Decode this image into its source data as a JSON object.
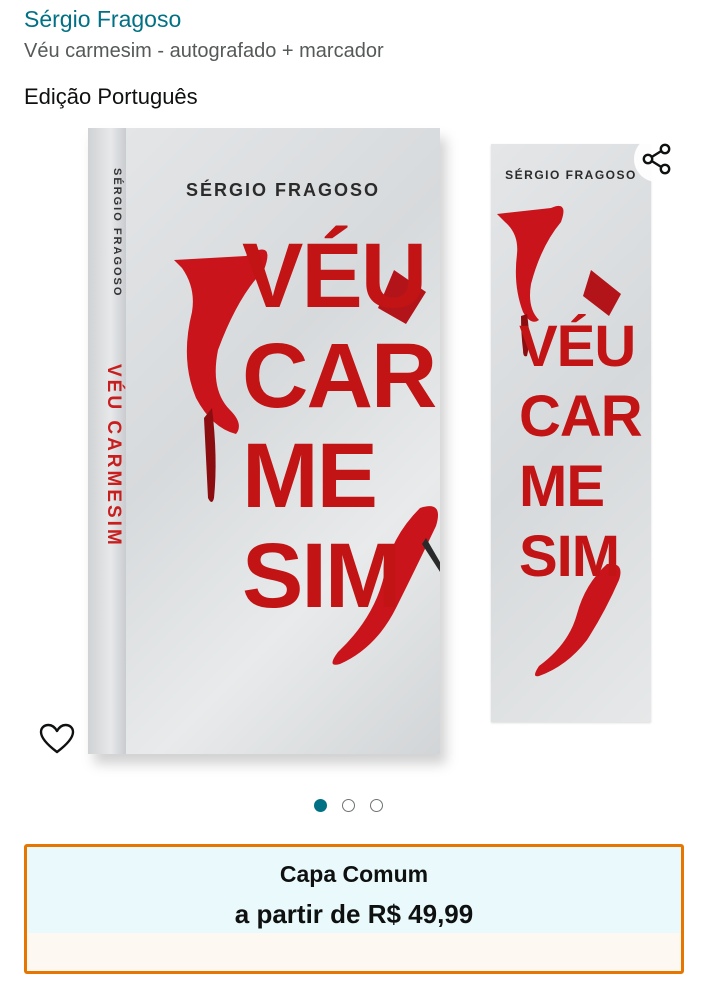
{
  "product": {
    "author": "Sérgio Fragoso",
    "title": "Véu carmesim - autografado + marcador",
    "edition": "Edição Português"
  },
  "images": {
    "book_cover": {
      "spine_author": "SÉRGIO FRAGOSO",
      "spine_title": "VÉU CARMESIM",
      "cover_author": "SÉRGIO FRAGOSO",
      "cover_title_lines": [
        "VÉU",
        "CAR",
        "ME",
        "SIM"
      ]
    },
    "bookmark": {
      "author": "SÉRGIO FRAGOSO",
      "title_lines": [
        "VÉU",
        "CAR",
        "ME",
        "SIM"
      ]
    },
    "carousel": {
      "total": 3,
      "active": 1
    },
    "icons": {
      "share": "share-icon",
      "wishlist": "heart-icon"
    }
  },
  "format": {
    "name": "Capa Comum",
    "price": "a partir de R$ 49,99"
  },
  "colors": {
    "link": "#007185",
    "accent_border": "#e77600",
    "cover_red": "#c21414"
  }
}
